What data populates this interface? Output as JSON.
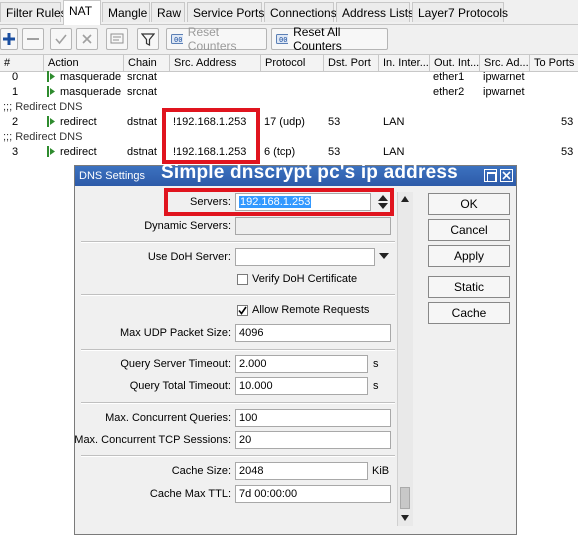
{
  "tabs": [
    {
      "label": "Filter Rules"
    },
    {
      "label": "NAT"
    },
    {
      "label": "Mangle"
    },
    {
      "label": "Raw"
    },
    {
      "label": "Service Ports"
    },
    {
      "label": "Connections"
    },
    {
      "label": "Address Lists"
    },
    {
      "label": "Layer7 Protocols"
    }
  ],
  "toolbar": {
    "reset_counters": "Reset Counters",
    "reset_all_counters": "Reset All Counters"
  },
  "table": {
    "columns": [
      "#",
      "Action",
      "Chain",
      "Src. Address",
      "Protocol",
      "Dst. Port",
      "In. Inter...",
      "Out. Int...",
      "Src. Ad...",
      "To Ports"
    ],
    "rows": [
      {
        "num": "0",
        "action": "masquerade",
        "chain": "srcnat",
        "src": "",
        "protocol": "",
        "dst_port": "",
        "in_iface": "",
        "out_iface": "ether1",
        "src_list": "ipwarnet",
        "to_ports": ""
      },
      {
        "num": "1",
        "action": "masquerade",
        "chain": "srcnat",
        "src": "",
        "protocol": "",
        "dst_port": "",
        "in_iface": "",
        "out_iface": "ether2",
        "src_list": "ipwarnet",
        "to_ports": ""
      },
      {
        "comment": ";;; Redirect DNS"
      },
      {
        "num": "2",
        "action": "redirect",
        "chain": "dstnat",
        "src": "!192.168.1.253",
        "protocol": "17 (udp)",
        "dst_port": "53",
        "in_iface": "LAN",
        "out_iface": "",
        "src_list": "",
        "to_ports": "53"
      },
      {
        "comment": ";;; Redirect DNS"
      },
      {
        "num": "3",
        "action": "redirect",
        "chain": "dstnat",
        "src": "!192.168.1.253",
        "protocol": "6 (tcp)",
        "dst_port": "53",
        "in_iface": "LAN",
        "out_iface": "",
        "src_list": "",
        "to_ports": "53"
      }
    ]
  },
  "dialog": {
    "title": "DNS Settings",
    "caption": "Simple dnscrypt pc's ip address",
    "fields": {
      "servers_label": "Servers:",
      "servers_value": "192.168.1.253",
      "dynamic_servers_label": "Dynamic Servers:",
      "dynamic_servers_value": "",
      "use_doh_label": "Use DoH Server:",
      "use_doh_value": "",
      "verify_doh_label": "Verify DoH Certificate",
      "allow_remote_label": "Allow Remote Requests",
      "max_udp_label": "Max UDP Packet Size:",
      "max_udp_value": "4096",
      "query_server_timeout_label": "Query Server Timeout:",
      "query_server_timeout_value": "2.000",
      "query_total_timeout_label": "Query Total Timeout:",
      "query_total_timeout_value": "10.000",
      "timeout_unit": "s",
      "max_concurrent_label": "Max. Concurrent Queries:",
      "max_concurrent_value": "100",
      "max_concurrent_tcp_label": "Max. Concurrent TCP Sessions:",
      "max_concurrent_tcp_value": "20",
      "cache_size_label": "Cache Size:",
      "cache_size_value": "2048",
      "cache_size_unit": "KiB",
      "cache_ttl_label": "Cache Max TTL:",
      "cache_ttl_value": "7d 00:00:00"
    },
    "buttons": {
      "ok": "OK",
      "cancel": "Cancel",
      "apply": "Apply",
      "static": "Static",
      "cache": "Cache"
    },
    "checkboxes": {
      "verify_doh": false,
      "allow_remote": true
    }
  },
  "colors": {
    "highlight_red": "#e0141e",
    "title_blue": "#2d5aa8",
    "selection_blue": "#3399ff"
  }
}
